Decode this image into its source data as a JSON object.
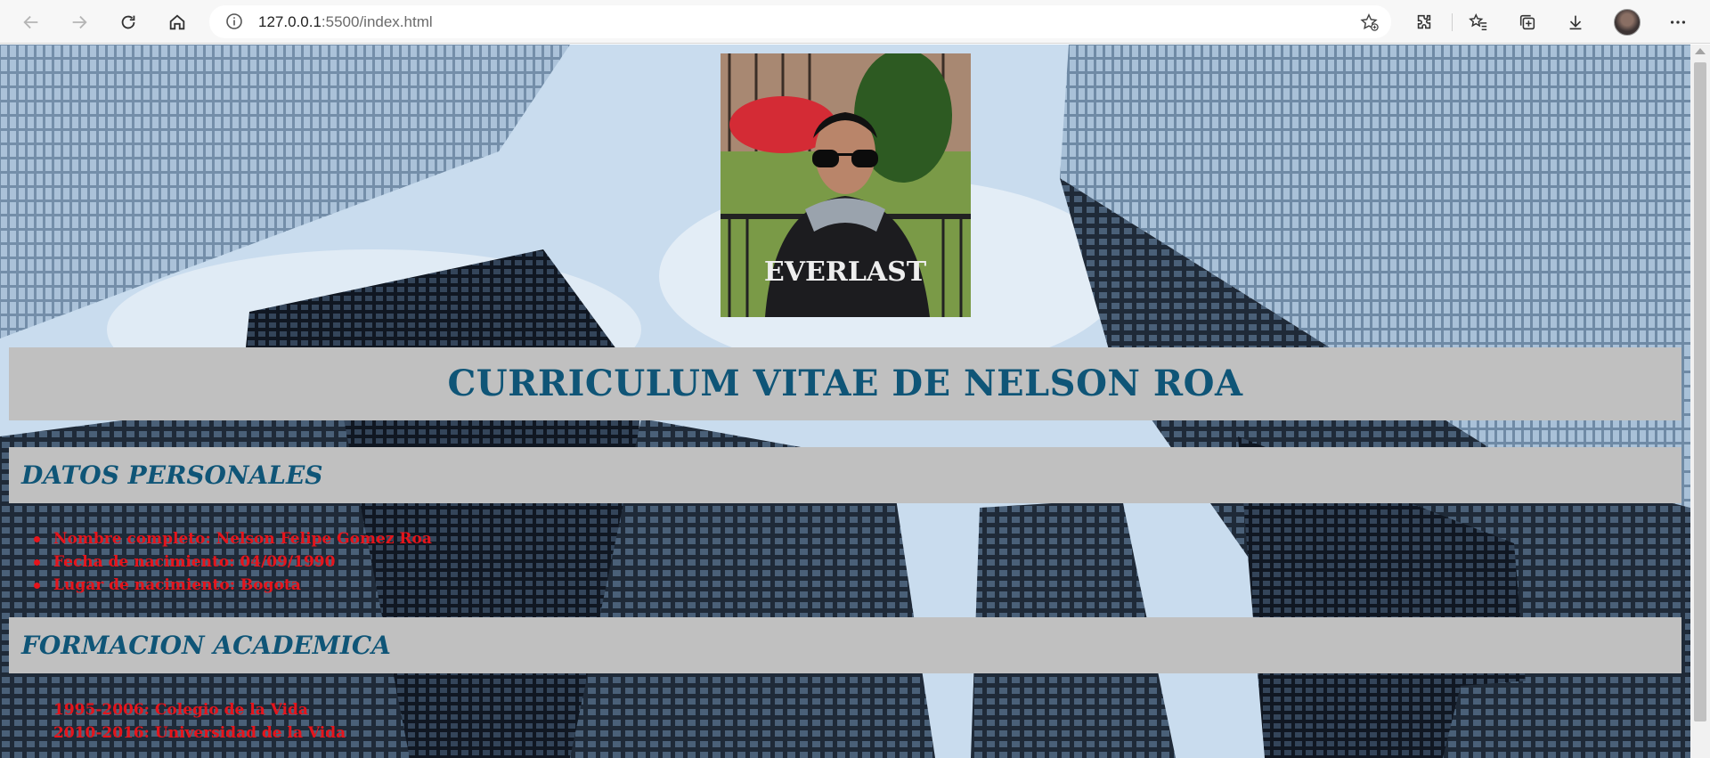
{
  "browser": {
    "url_host": "127.0.0.1",
    "url_rest": ":5500/index.html"
  },
  "page": {
    "title": "CURRICULUM VITAE DE NELSON ROA",
    "sections": [
      {
        "heading": "DATOS PERSONALES",
        "items": [
          "Nombre completo: Nelson Felipe Gomez Roa",
          "Fecha de nacimiento: 04/09/1990",
          "Lugar de nacimiento: Bogota"
        ]
      },
      {
        "heading": "FORMACION ACADEMICA",
        "items": [
          "1995-2006: Colegio de la Vida",
          "2010-2016: Universidad de la Vida"
        ]
      }
    ]
  },
  "colors": {
    "heading": "#0f5577",
    "band": "#c0c0c0",
    "list_text": "#e6141b"
  }
}
